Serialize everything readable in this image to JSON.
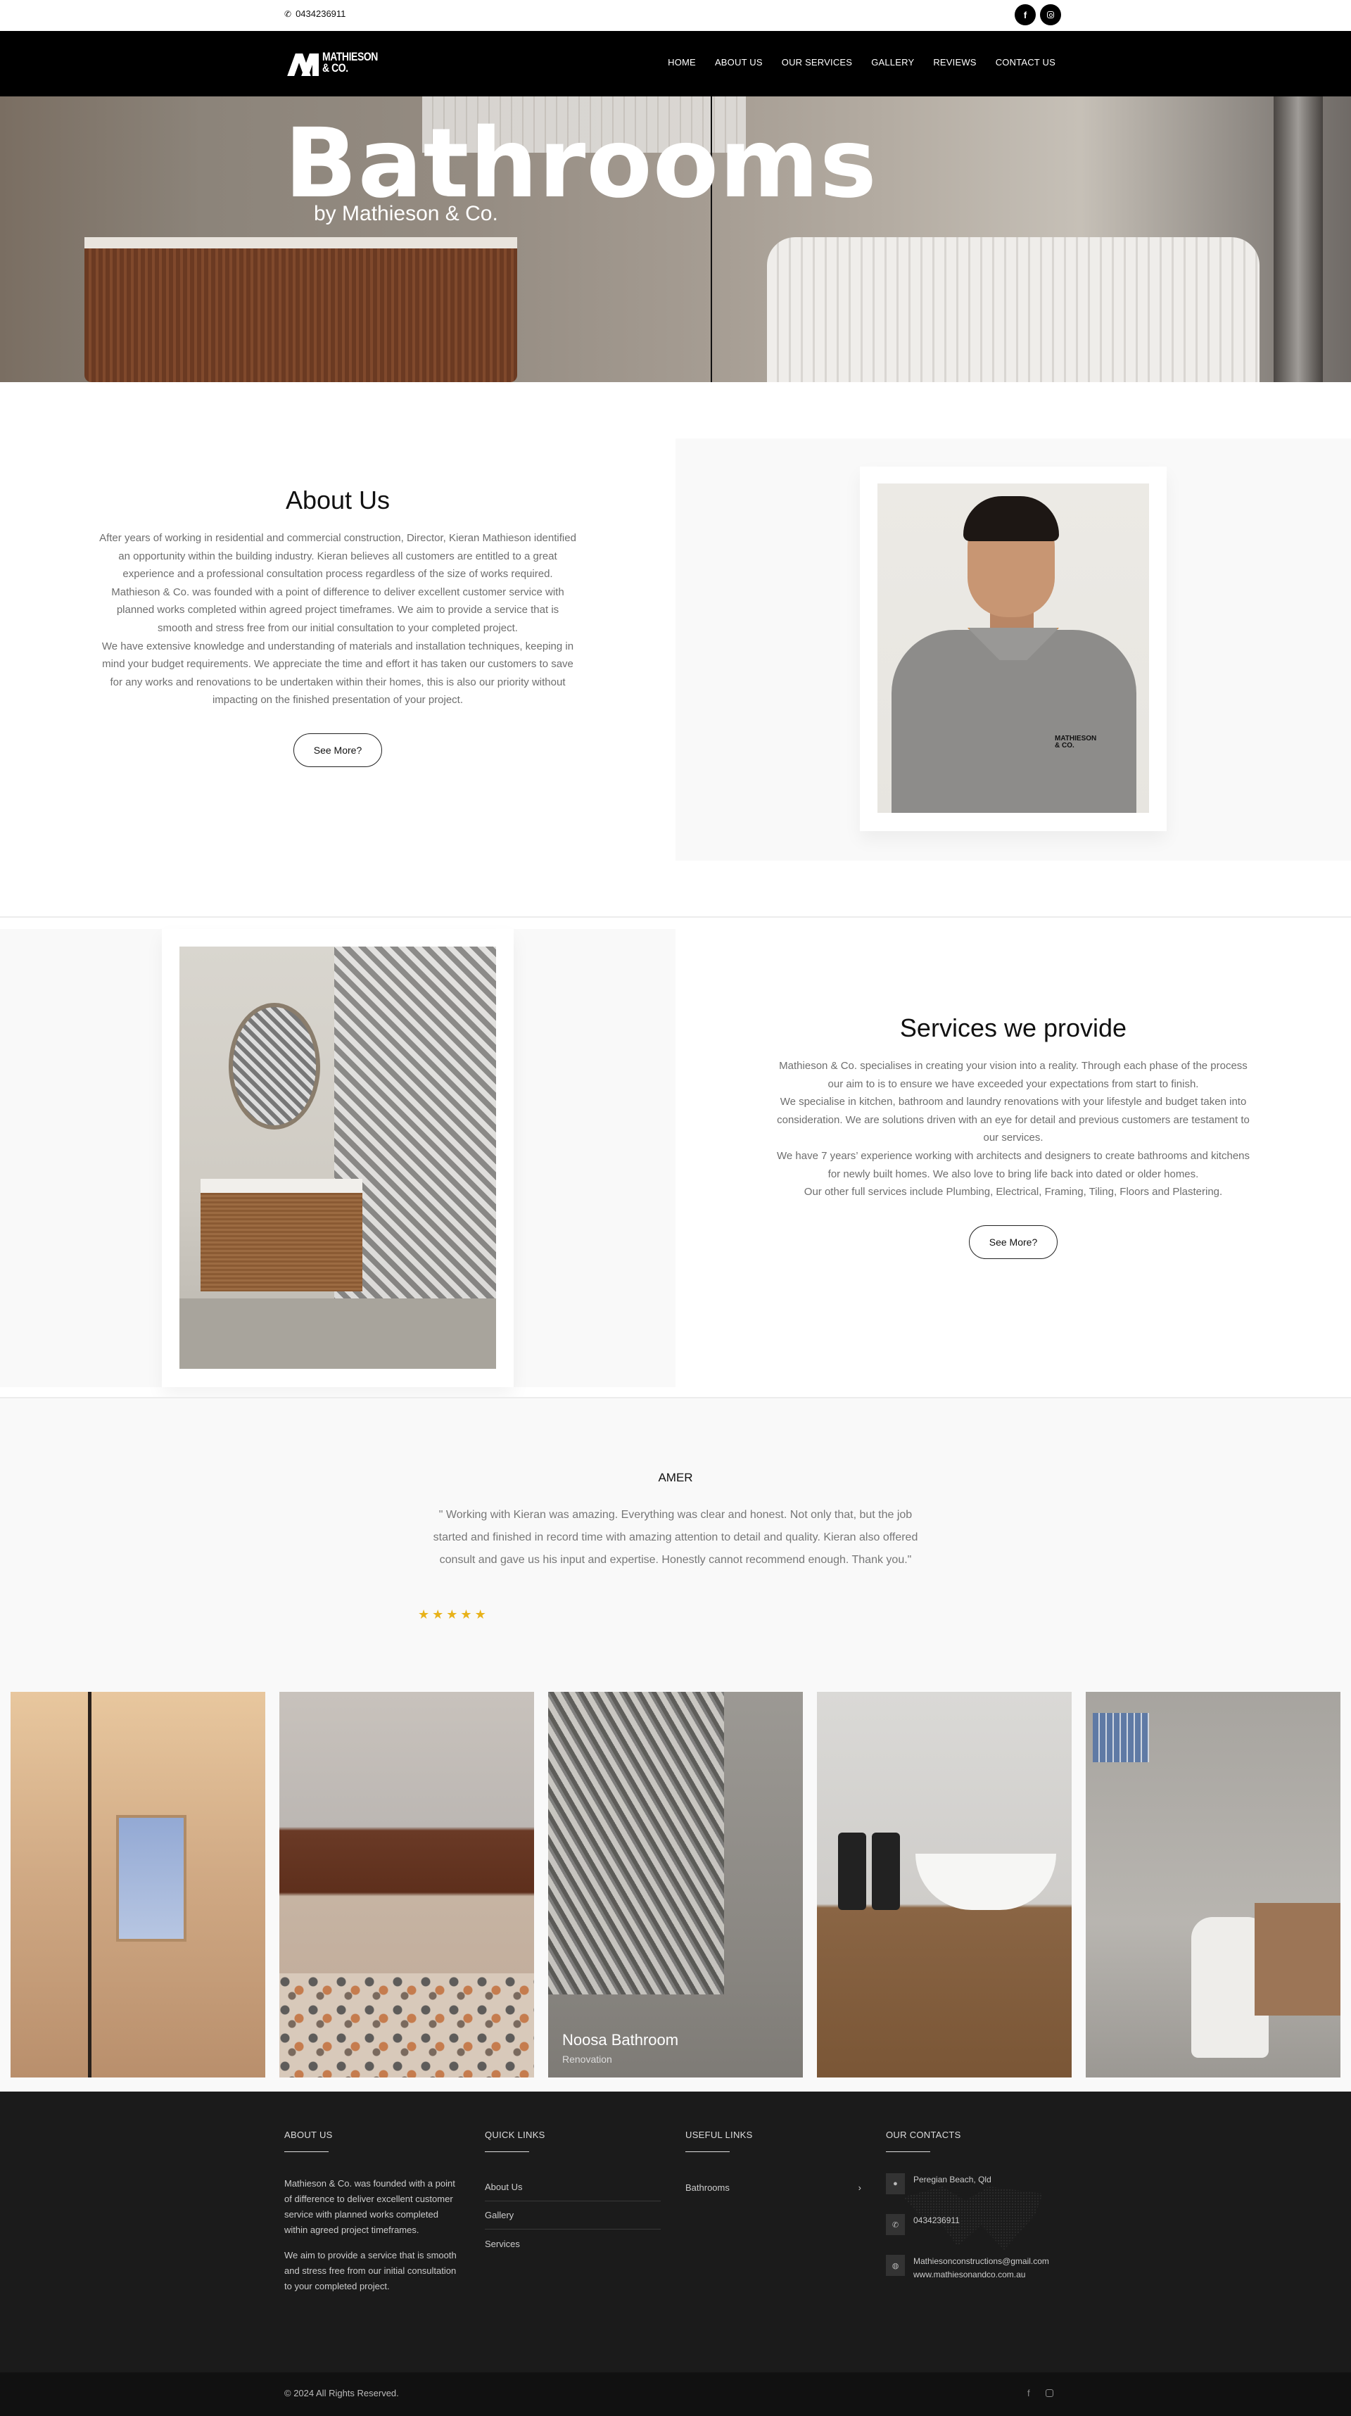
{
  "topbar": {
    "phone_icon": "phone-icon",
    "phone": "0434236911",
    "social": [
      {
        "name": "facebook-icon",
        "glyph": "f"
      },
      {
        "name": "instagram-icon",
        "glyph": ""
      }
    ]
  },
  "nav": {
    "logo_line1": "MATHIESON",
    "logo_line2": "& CO.",
    "items": [
      {
        "label": "HOME"
      },
      {
        "label": "ABOUT US"
      },
      {
        "label": "OUR SERVICES"
      },
      {
        "label": "GALLERY"
      },
      {
        "label": "REVIEWS"
      },
      {
        "label": "CONTACT US"
      }
    ]
  },
  "hero": {
    "title": "Bathrooms",
    "subtitle": "by Mathieson & Co."
  },
  "about": {
    "title": "About Us",
    "paragraphs": [
      "After years of working in residential and commercial construction, Director, Kieran Mathieson identified an opportunity within the building industry. Kieran believes all customers are entitled to a great experience and a professional consultation process regardless of the size of works required.",
      "Mathieson & Co. was founded with a point of difference to deliver excellent customer service with planned works completed within agreed project timeframes. We aim to provide a service that is smooth and stress free from our initial consultation to your completed project.",
      "We have extensive knowledge and understanding of materials and installation techniques, keeping in mind your budget requirements. We appreciate the time and effort it has taken our customers to save for any works and renovations to be undertaken within their homes, this is also our priority without impacting on the finished presentation of your project."
    ],
    "button": "See More?",
    "photo_embroidery_1": "MATHIESON",
    "photo_embroidery_2": "& CO."
  },
  "services": {
    "title": "Services we provide",
    "paragraphs": [
      "Mathieson & Co. specialises in creating your vision into a reality. Through each phase of the process our aim to is to ensure we have exceeded your expectations from start to finish.",
      "We specialise in kitchen, bathroom and laundry renovations with your lifestyle and budget taken into consideration. We are solutions driven with an eye for detail and previous customers are testament to our services.",
      "We have 7 years’ experience working with architects and designers to create bathrooms and kitchens for newly built homes. We also love to bring life back into dated or older homes.",
      "Our other full services include Plumbing, Electrical, Framing, Tiling, Floors and Plastering."
    ],
    "button": "See More?"
  },
  "testimonial": {
    "name": "AMER",
    "quote": "\" Working with Kieran was amazing. Everything was clear and honest. Not only that, but the job started and finished in record time with amazing attention to detail and quality. Kieran also offered consult and gave us his input and expertise. Honestly cannot recommend enough. Thank you.\"",
    "rating": 5,
    "rating_max": 5,
    "star_color": "#e8b21a"
  },
  "gallery": {
    "items": [
      {
        "title": "",
        "subtitle": ""
      },
      {
        "title": "",
        "subtitle": ""
      },
      {
        "title": "Noosa Bathroom",
        "subtitle": "Renovation"
      },
      {
        "title": "",
        "subtitle": ""
      },
      {
        "title": "",
        "subtitle": ""
      }
    ]
  },
  "footer": {
    "about": {
      "heading": "ABOUT US",
      "paragraphs": [
        "Mathieson & Co. was founded with a point of difference to deliver excellent customer service with planned works completed within agreed project timeframes.",
        "We aim to provide a service that is smooth and stress free from our initial consultation to your completed project."
      ]
    },
    "quick_links": {
      "heading": "QUICK LINKS",
      "items": [
        {
          "label": "About Us"
        },
        {
          "label": "Gallery"
        },
        {
          "label": "Services"
        }
      ]
    },
    "useful_links": {
      "heading": "USEFUL LINKS",
      "items": [
        {
          "label": "Bathrooms",
          "chevron": "›"
        }
      ]
    },
    "contacts": {
      "heading": "OUR CONTACTS",
      "items": [
        {
          "icon": "map-pin-icon",
          "glyph": "⬤",
          "lines": [
            "Peregian Beach, Qld"
          ]
        },
        {
          "icon": "phone-icon",
          "glyph": "✆",
          "lines": [
            "0434236911"
          ]
        },
        {
          "icon": "globe-icon",
          "glyph": "◍",
          "lines": [
            "Mathiesonconstructions@gmail.com",
            "www.mathiesonandco.com.au"
          ]
        }
      ]
    },
    "copyright": "© 2024 All Rights Reserved.",
    "social": [
      {
        "name": "facebook-icon",
        "glyph": "f"
      },
      {
        "name": "instagram-icon",
        "glyph": ""
      }
    ]
  }
}
